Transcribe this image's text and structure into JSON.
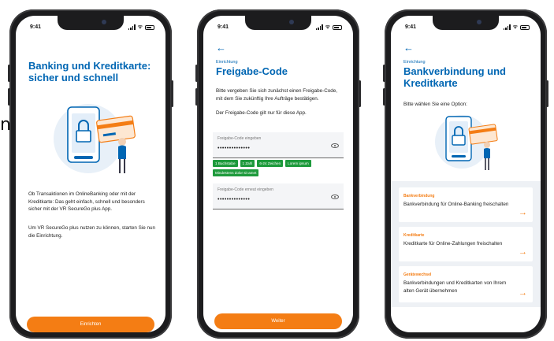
{
  "stray_text": "n",
  "status": {
    "time": "9:41"
  },
  "screen1": {
    "title": "Banking und Kreditkarte: sicher und schnell",
    "para1": "Ob Transaktionen im OnlineBanking oder mit der Kreditkarte: Das geht einfach, schnell und besonders sicher mit der VR SecureGo plus App.",
    "para2": "Um VR SecureGo plus nutzen zu können, starten Sie nun die Einrichtung.",
    "button": "Einrichten"
  },
  "screen2": {
    "back": "←",
    "overline": "Einrichtung",
    "title": "Freigabe-Code",
    "para1": "Bitte vergeben Sie sich zunächst einen Freigabe-Code, mit dem Sie zukünftig Ihre Aufträge bestätigen.",
    "para2": "Der Freigabe-Code gilt nur für diese App.",
    "field1": {
      "label": "Freigabe-Code eingeben",
      "value": "••••••••••••••"
    },
    "chips": [
      "1 Buchstabe",
      "1 Zahl",
      "6-24 Zeichen",
      "Lorem ipsum",
      "Mindestens dolor sit amet"
    ],
    "field2": {
      "label": "Freigabe-Code erneut eingeben",
      "value": "••••••••••••••"
    },
    "button": "Weiter"
  },
  "screen3": {
    "back": "←",
    "overline": "Einrichtung",
    "title": "Bankverbindung und Kreditkarte",
    "para": "Bitte wählen Sie eine Option:",
    "cards": [
      {
        "category": "Bankverbindung",
        "text": "Bankverbindung für Online-Banking freischalten",
        "arrow": "→"
      },
      {
        "category": "Kreditkarte",
        "text": "Kreditkarte für Online-Zahlungen freischalten",
        "arrow": "→"
      },
      {
        "category": "Gerätewechsel",
        "text": "Bankverbindungen und Kreditkarten von Ihrem alten Gerät übernehmen",
        "arrow": "→"
      }
    ]
  },
  "colors": {
    "primary": "#0066b3",
    "accent": "#f47d14",
    "success": "#1e9a3c"
  }
}
